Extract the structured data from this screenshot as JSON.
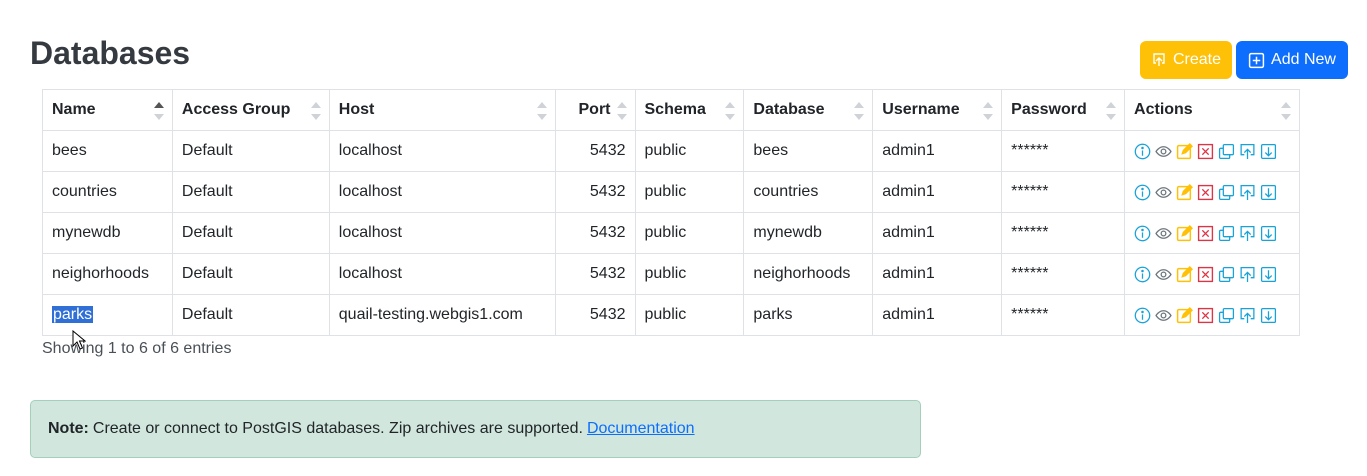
{
  "page": {
    "title": "Databases"
  },
  "toolbar": {
    "create_label": "Create",
    "add_new_label": "Add New"
  },
  "table": {
    "columns": [
      "Name",
      "Access Group",
      "Host",
      "Port",
      "Schema",
      "Database",
      "Username",
      "Password",
      "Actions"
    ],
    "sorted_column": "Name",
    "rows": [
      {
        "name": "bees",
        "access_group": "Default",
        "host": "localhost",
        "port": "5432",
        "schema": "public",
        "database": "bees",
        "username": "admin1",
        "password": "******"
      },
      {
        "name": "countries",
        "access_group": "Default",
        "host": "localhost",
        "port": "5432",
        "schema": "public",
        "database": "countries",
        "username": "admin1",
        "password": "******"
      },
      {
        "name": "mynewdb",
        "access_group": "Default",
        "host": "localhost",
        "port": "5432",
        "schema": "public",
        "database": "mynewdb",
        "username": "admin1",
        "password": "******"
      },
      {
        "name": "neighorhoods",
        "access_group": "Default",
        "host": "localhost",
        "port": "5432",
        "schema": "public",
        "database": "neighorhoods",
        "username": "admin1",
        "password": "******"
      },
      {
        "name": "parks",
        "access_group": "Default",
        "host": "quail-testing.webgis1.com",
        "port": "5432",
        "schema": "public",
        "database": "parks",
        "username": "admin1",
        "password": "******"
      }
    ],
    "row_actions": [
      "info-icon",
      "view-icon",
      "edit-icon",
      "delete-icon",
      "copy-icon",
      "upload-icon",
      "download-icon"
    ],
    "info": "Showing 1 to 6 of 6 entries"
  },
  "note": {
    "label": "Note:",
    "text": "Create or connect to PostGIS databases. Zip archives are supported.",
    "link": "Documentation"
  },
  "colors": {
    "create_button": "#ffc107",
    "add_button": "#0d6efd",
    "note_bg": "#d1e7dd",
    "action_info": "#17a2d8",
    "action_view": "#6c757d",
    "action_edit": "#ffc107",
    "action_delete": "#dc3545"
  }
}
